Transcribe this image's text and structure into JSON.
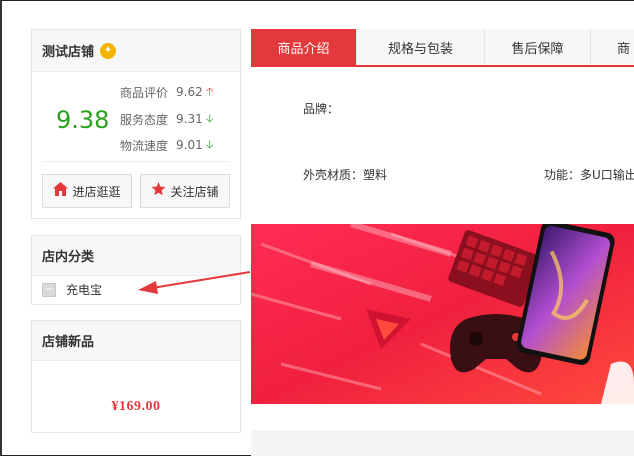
{
  "shop": {
    "name": "测试店铺",
    "score": "9.38",
    "ratings": [
      {
        "label": "商品评价",
        "value": "9.62",
        "trend": "up"
      },
      {
        "label": "服务态度",
        "value": "9.31",
        "trend": "down"
      },
      {
        "label": "物流速度",
        "value": "9.01",
        "trend": "down"
      }
    ],
    "enter_label": "进店逛逛",
    "follow_label": "关注店铺"
  },
  "categories": {
    "title": "店内分类",
    "items": [
      {
        "label": "充电宝"
      }
    ]
  },
  "new_items": {
    "title": "店铺新品",
    "price": "¥169.00"
  },
  "tabs": [
    {
      "label": "商品介绍",
      "active": true
    },
    {
      "label": "规格与包装",
      "active": false
    },
    {
      "label": "售后保障",
      "active": false
    },
    {
      "label": "商",
      "active": false
    }
  ],
  "specs": {
    "brand_label": "品牌：",
    "material": "外壳材质：塑料",
    "function": "功能：多U口输出"
  },
  "colors": {
    "accent": "#e4393c",
    "score_green": "#2aa21f"
  }
}
